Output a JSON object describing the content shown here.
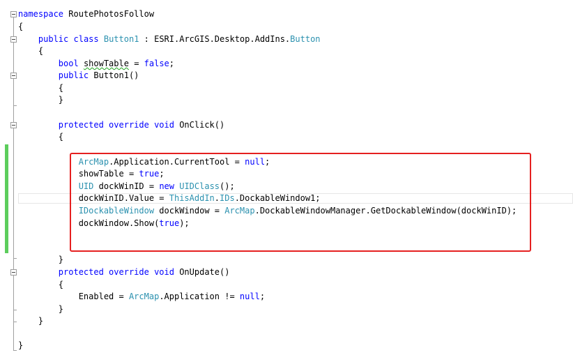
{
  "editor": {
    "lines": {
      "l1": {
        "kw": "namespace",
        "rest": " RoutePhotosFollow"
      },
      "l2": {
        "text": "{"
      },
      "l3": {
        "kw1": "public",
        "kw2": "class",
        "name": " Button1",
        "mid": " : ESRI.ArcGIS.Desktop.AddIns.",
        "type": "Button"
      },
      "l4": {
        "text": "{"
      },
      "l5": {
        "kw": "bool",
        "ident": "showTable",
        "eq": " = ",
        "val": "false",
        "semi": ";"
      },
      "l6": {
        "kw": "public",
        "rest": " Button1()"
      },
      "l7": {
        "text": "{"
      },
      "l8": {
        "text": "}"
      },
      "l9": {
        "kw": "protected override void",
        "rest": " OnClick()"
      },
      "l10": {
        "text": "{"
      },
      "l11": {
        "type": "ArcMap",
        "mid": ".Application.CurrentTool = ",
        "kw": "null",
        "semi": ";"
      },
      "l12": {
        "pre": "showTable = ",
        "kw": "true",
        "semi": ";"
      },
      "l13": {
        "type1": "UID",
        "mid": " dockWinID = ",
        "kw": "new",
        "sp": " ",
        "type2": "UIDClass",
        "end": "();"
      },
      "l14": {
        "pre": "dockWinID.Value = ",
        "type1": "ThisAddIn",
        "dot": ".",
        "type2": "IDs",
        "end": ".DockableWindow1;"
      },
      "l15": {
        "type1": "IDockableWindow",
        "mid": " dockWindow = ",
        "type2": "ArcMap",
        "end": ".DockableWindowManager.GetDockableWindow(dockWinID);"
      },
      "l16": {
        "pre": "dockWindow.Show(",
        "kw": "true",
        "end": ");"
      },
      "l17": {
        "text": "}"
      },
      "l18": {
        "kw": "protected override void",
        "rest": " OnUpdate()"
      },
      "l19": {
        "text": "{"
      },
      "l20": {
        "pre": "Enabled = ",
        "type": "ArcMap",
        "mid": ".Application != ",
        "kw": "null",
        "semi": ";"
      },
      "l21": {
        "text": "}"
      },
      "l22": {
        "text": "}"
      },
      "l23": {
        "text": "}"
      }
    },
    "colors": {
      "keyword": "#0000ff",
      "type": "#2b91af",
      "text": "#000000",
      "change_bar": "#5ccd5c",
      "highlight": "#e52020"
    }
  }
}
